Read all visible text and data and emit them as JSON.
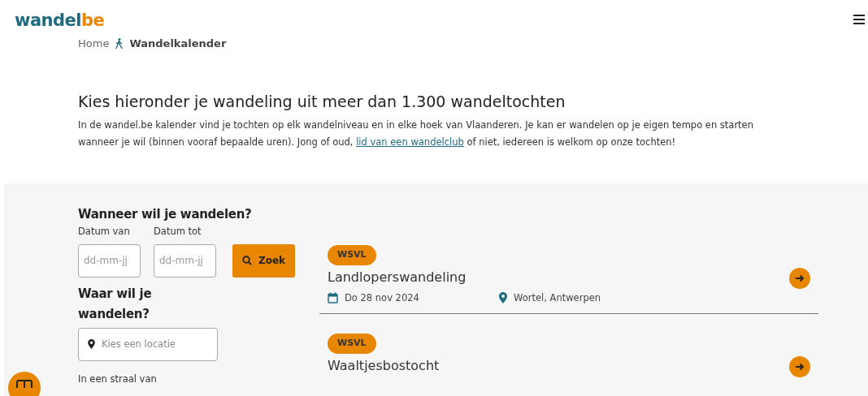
{
  "logo": {
    "part_1": "wandel",
    "part_2": "be"
  },
  "breadcrumb": [
    {
      "label": "Home",
      "current": false
    },
    {
      "label": "Wandelkalender",
      "current": true
    }
  ],
  "intro": {
    "heading": "Kies hieronder je wandeling uit meer dan 1.300 wandeltochten",
    "text_before": "In de wandel.be kalender vind je tochten op elk wandelniveau en in elke hoek van Vlaanderen. Je kan er wandelen op je eigen tempo en starten wanneer je wil (binnen vooraf bepaalde uren). Jong of oud, ",
    "link": "lid van een wandelclub",
    "text_after": " of niet, iedereen is welkom op onze tochten!"
  },
  "filters": {
    "when_heading": "Wanneer wil je wandelen?",
    "date_from": {
      "label": "Datum van",
      "placeholder": "dd-mm-jj"
    },
    "date_to": {
      "label": "Datum tot",
      "placeholder": "dd-mm-jj"
    },
    "search_button": "Zoek",
    "where_heading": "Waar wil je wandelen?",
    "location": {
      "placeholder": "Kies een locatie"
    },
    "radius_label": "In een straal van"
  },
  "events": [
    {
      "org": "WSVL",
      "title": "Landloperswandeling",
      "date": "Do 28 nov 2024",
      "location": "Wortel, Antwerpen"
    },
    {
      "org": "WSVL",
      "title": "Waaltjesbostocht"
    }
  ]
}
